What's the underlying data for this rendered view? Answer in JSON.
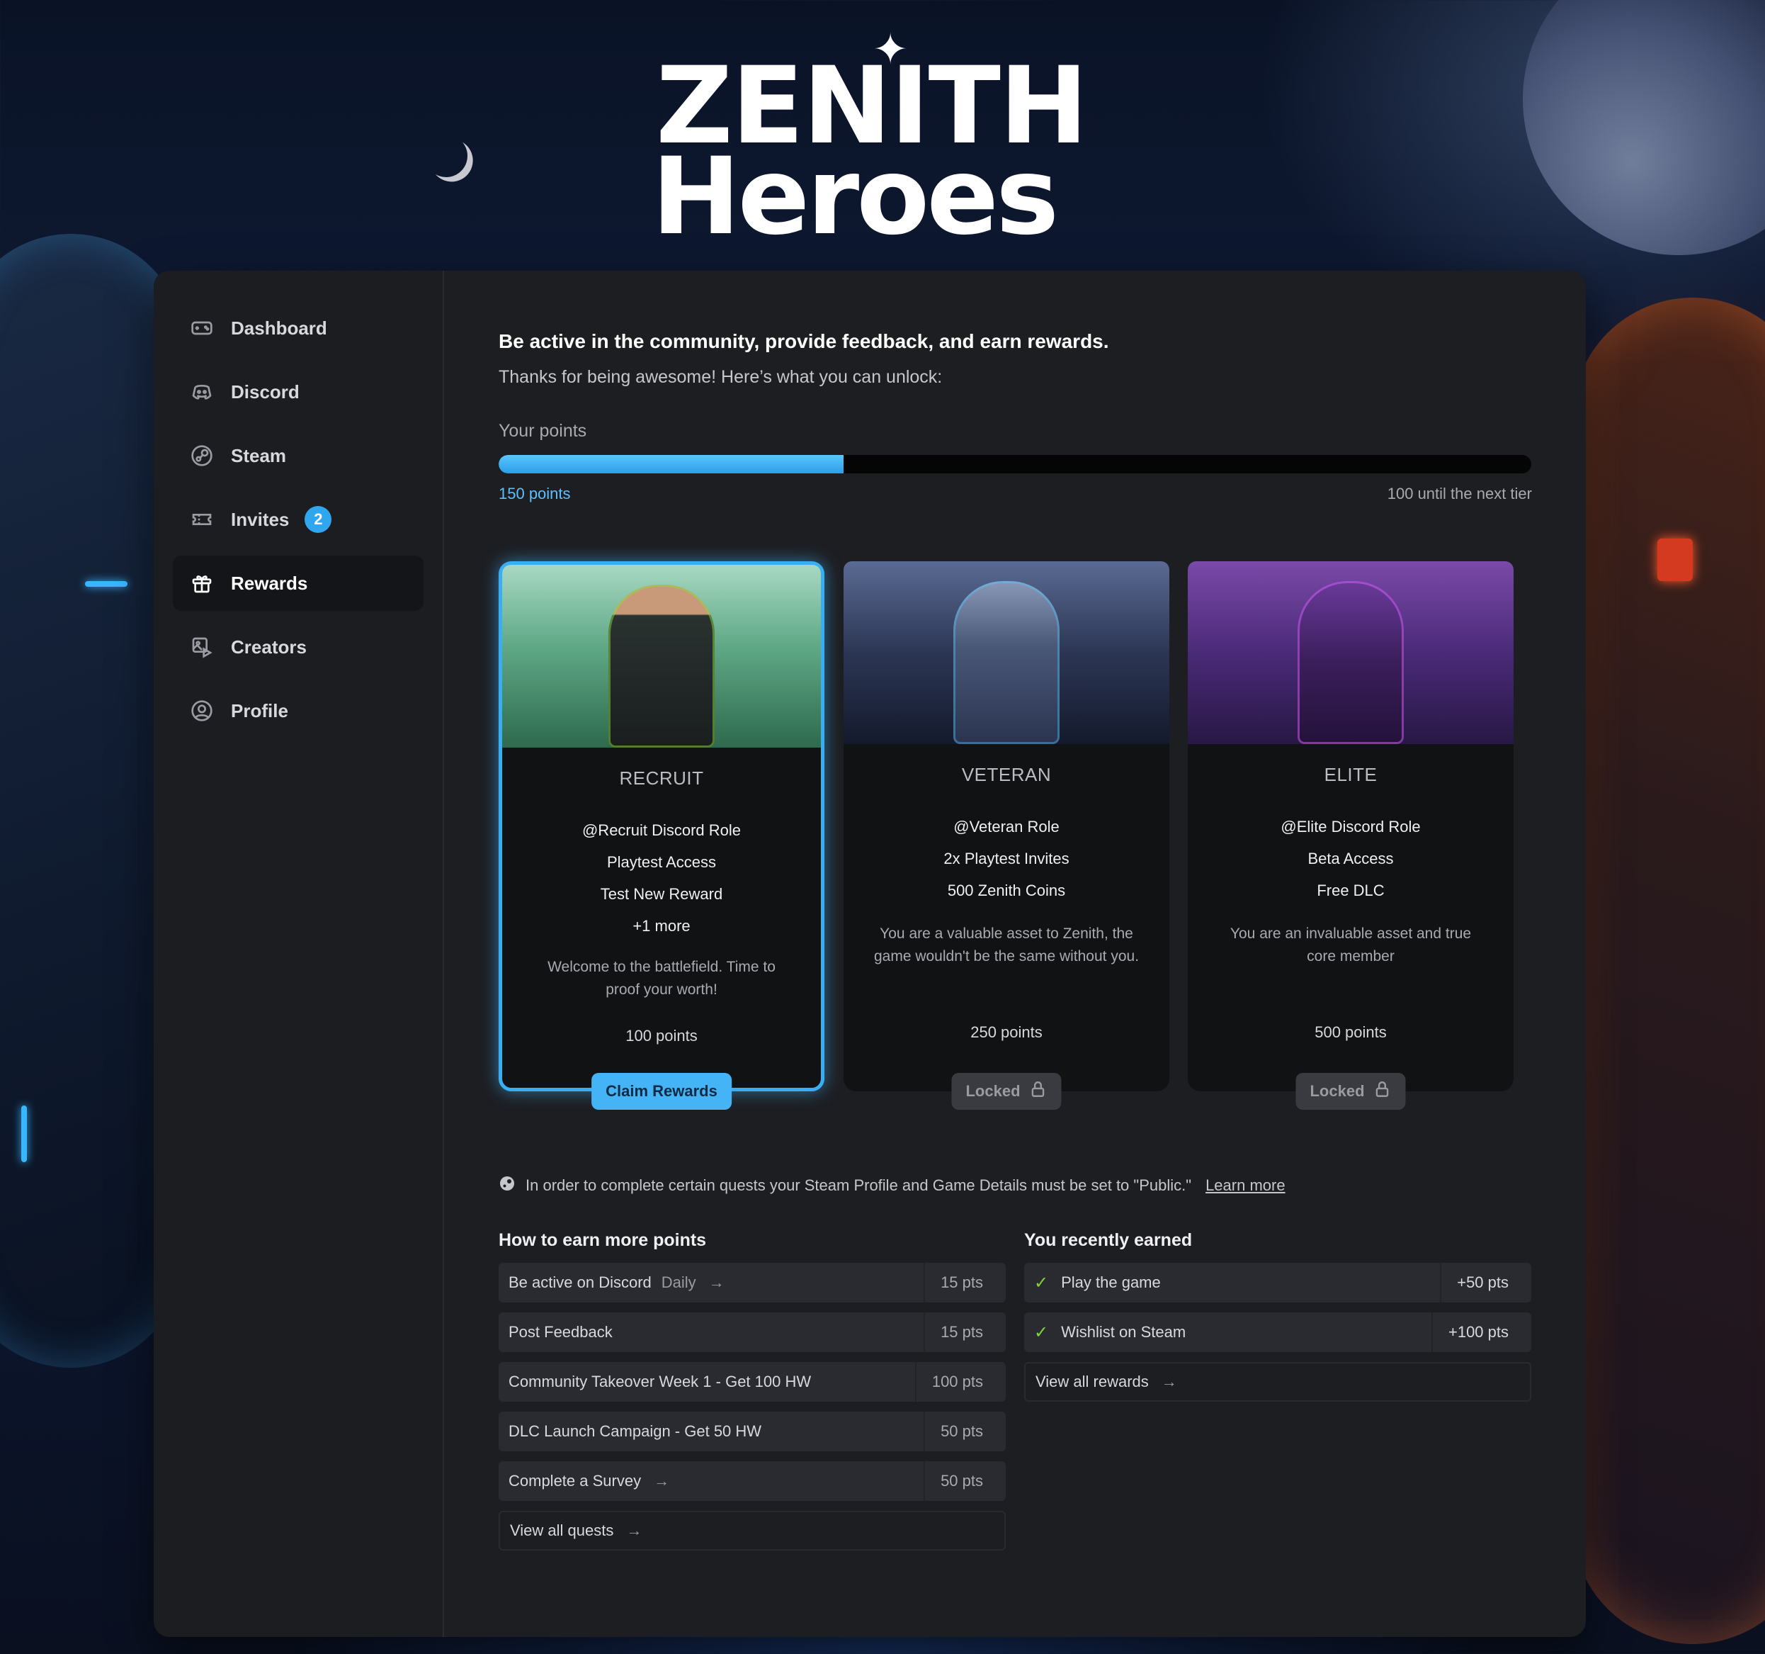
{
  "brand": {
    "logo_line1": "ZENITH",
    "logo_line2": "Heroes"
  },
  "sidebar": {
    "items": [
      {
        "label": "Dashboard",
        "icon": "gamepad-icon"
      },
      {
        "label": "Discord",
        "icon": "discord-icon"
      },
      {
        "label": "Steam",
        "icon": "steam-icon"
      },
      {
        "label": "Invites",
        "icon": "ticket-icon",
        "badge": "2"
      },
      {
        "label": "Rewards",
        "icon": "gift-icon",
        "active": true
      },
      {
        "label": "Creators",
        "icon": "creators-icon"
      },
      {
        "label": "Profile",
        "icon": "user-circle-icon"
      }
    ]
  },
  "main": {
    "headline": "Be active in the community, provide feedback, and earn rewards.",
    "subline": "Thanks for being awesome! Here’s what you can unlock:",
    "points_label": "Your points",
    "points_current": "150 points",
    "points_next": "100 until the next tier",
    "progress_fraction": 0.334,
    "accent_color": "#3aaef2"
  },
  "tiers": [
    {
      "title": "RECRUIT",
      "perks": [
        "@Recruit Discord Role",
        "Playtest Access",
        "Test New Reward",
        "+1 more"
      ],
      "description": "Welcome to the battlefield. Time to proof your worth!",
      "points": "100 points",
      "button": "Claim Rewards"
    },
    {
      "title": "VETERAN",
      "perks": [
        "@Veteran Role",
        "2x Playtest Invites",
        "500 Zenith Coins"
      ],
      "description": "You are a valuable asset to Zenith, the game wouldn't be the same without you.",
      "points": "250 points",
      "button": "Locked"
    },
    {
      "title": "ELITE",
      "perks": [
        "@Elite Discord Role",
        "Beta Access",
        "Free DLC"
      ],
      "description": "You are an invaluable asset and true core member",
      "points": "500 points",
      "button": "Locked"
    }
  ],
  "notice": {
    "text": "In order to complete certain quests your Steam Profile and Game Details must be set to \"Public.\"",
    "link": "Learn more"
  },
  "quests": {
    "title": "How to earn more points",
    "items": [
      {
        "label": "Be active on Discord",
        "tag": "Daily",
        "pts": "15 pts"
      },
      {
        "label": "Post Feedback",
        "pts": "15 pts"
      },
      {
        "label": "Community Takeover Week 1 - Get 100 HW",
        "pts": "100 pts"
      },
      {
        "label": "DLC Launch Campaign - Get 50 HW",
        "pts": "50 pts"
      },
      {
        "label": "Complete a Survey",
        "pts": "50 pts"
      }
    ],
    "view_all": "View all quests"
  },
  "earned": {
    "title": "You recently earned",
    "items": [
      {
        "label": "Play the game",
        "pts": "+50 pts"
      },
      {
        "label": "Wishlist on Steam",
        "pts": "+100 pts"
      }
    ],
    "view_all": "View all rewards"
  }
}
